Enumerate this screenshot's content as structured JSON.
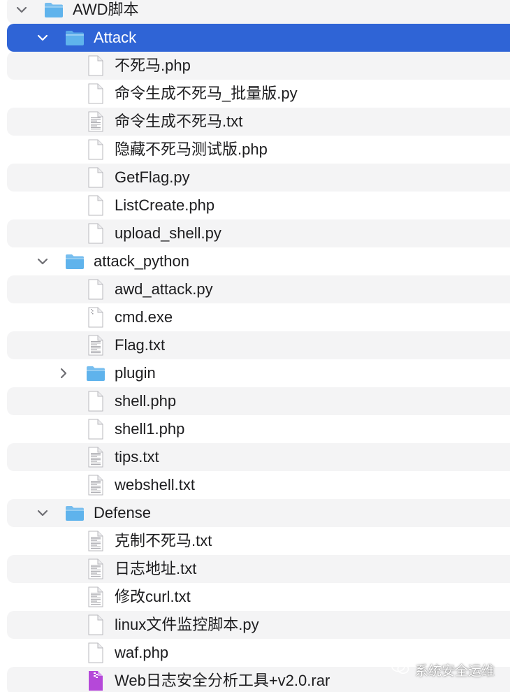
{
  "colors": {
    "selection": "#2f64d6",
    "stripe": "#f4f4f5",
    "folder": "#5fb3ec",
    "archive": "#b548d9"
  },
  "rows": [
    {
      "label": "AWD脚本",
      "level": 0,
      "type": "folder",
      "icon": "folder-icon",
      "disclosure": "expanded",
      "selected": false
    },
    {
      "label": "Attack",
      "level": 1,
      "type": "folder",
      "icon": "folder-icon",
      "disclosure": "expanded",
      "selected": true
    },
    {
      "label": "不死马.php",
      "level": 2,
      "type": "file",
      "icon": "document-icon",
      "disclosure": "none",
      "selected": false
    },
    {
      "label": "命令生成不死马_批量版.py",
      "level": 2,
      "type": "file",
      "icon": "document-icon",
      "disclosure": "none",
      "selected": false
    },
    {
      "label": "命令生成不死马.txt",
      "level": 2,
      "type": "text",
      "icon": "text-document-icon",
      "disclosure": "none",
      "selected": false
    },
    {
      "label": "隐藏不死马测试版.php",
      "level": 2,
      "type": "file",
      "icon": "document-icon",
      "disclosure": "none",
      "selected": false
    },
    {
      "label": "GetFlag.py",
      "level": 2,
      "type": "file",
      "icon": "document-icon",
      "disclosure": "none",
      "selected": false
    },
    {
      "label": "ListCreate.php",
      "level": 2,
      "type": "file",
      "icon": "document-icon",
      "disclosure": "none",
      "selected": false
    },
    {
      "label": "upload_shell.py",
      "level": 2,
      "type": "file",
      "icon": "document-icon",
      "disclosure": "none",
      "selected": false
    },
    {
      "label": "attack_python",
      "level": 1,
      "type": "folder",
      "icon": "folder-icon",
      "disclosure": "expanded",
      "selected": false
    },
    {
      "label": "awd_attack.py",
      "level": 2,
      "type": "file",
      "icon": "document-icon",
      "disclosure": "none",
      "selected": false
    },
    {
      "label": "cmd.exe",
      "level": 2,
      "type": "exe",
      "icon": "executable-icon",
      "disclosure": "none",
      "selected": false
    },
    {
      "label": "Flag.txt",
      "level": 2,
      "type": "text",
      "icon": "text-document-icon",
      "disclosure": "none",
      "selected": false
    },
    {
      "label": "plugin",
      "level": 2,
      "type": "folder",
      "icon": "folder-icon",
      "disclosure": "collapsed",
      "selected": false
    },
    {
      "label": "shell.php",
      "level": 2,
      "type": "file",
      "icon": "document-icon",
      "disclosure": "none",
      "selected": false
    },
    {
      "label": "shell1.php",
      "level": 2,
      "type": "file",
      "icon": "document-icon",
      "disclosure": "none",
      "selected": false
    },
    {
      "label": "tips.txt",
      "level": 2,
      "type": "text",
      "icon": "text-document-icon",
      "disclosure": "none",
      "selected": false
    },
    {
      "label": "webshell.txt",
      "level": 2,
      "type": "text",
      "icon": "text-document-icon",
      "disclosure": "none",
      "selected": false
    },
    {
      "label": "Defense",
      "level": 1,
      "type": "folder",
      "icon": "folder-icon",
      "disclosure": "expanded",
      "selected": false
    },
    {
      "label": "克制不死马.txt",
      "level": 2,
      "type": "text",
      "icon": "text-document-icon",
      "disclosure": "none",
      "selected": false
    },
    {
      "label": "日志地址.txt",
      "level": 2,
      "type": "text",
      "icon": "text-document-icon",
      "disclosure": "none",
      "selected": false
    },
    {
      "label": "修改curl.txt",
      "level": 2,
      "type": "text",
      "icon": "text-document-icon",
      "disclosure": "none",
      "selected": false
    },
    {
      "label": "linux文件监控脚本.py",
      "level": 2,
      "type": "file",
      "icon": "document-icon",
      "disclosure": "none",
      "selected": false
    },
    {
      "label": "waf.php",
      "level": 2,
      "type": "file",
      "icon": "document-icon",
      "disclosure": "none",
      "selected": false
    },
    {
      "label": "Web日志安全分析工具+v2.0.rar",
      "level": 2,
      "type": "archive",
      "icon": "archive-icon",
      "disclosure": "none",
      "selected": false
    }
  ],
  "watermark": {
    "text": "系统安全运维",
    "icon": "wechat-icon"
  }
}
